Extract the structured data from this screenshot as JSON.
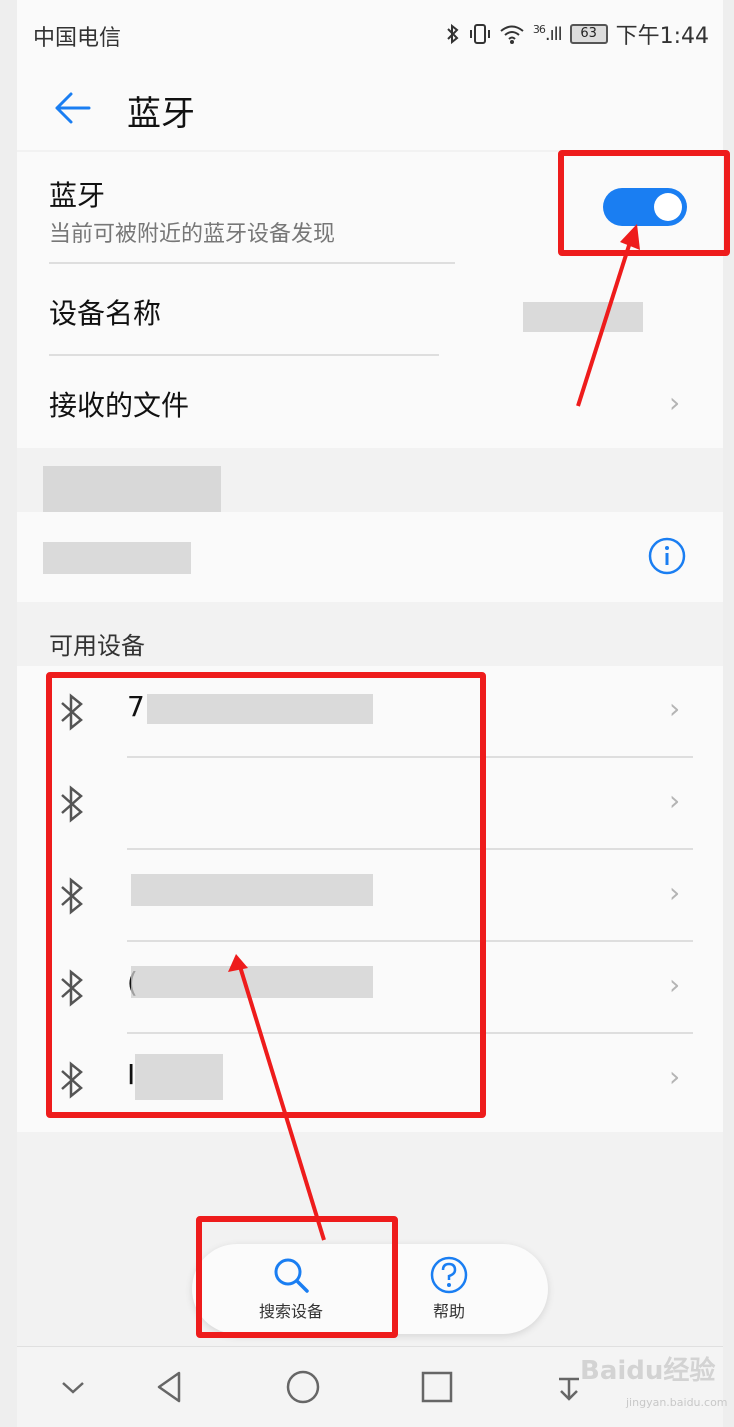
{
  "status_bar": {
    "carrier": "中国电信",
    "network": "36",
    "battery": "63",
    "time": "下午1:44"
  },
  "header": {
    "title": "蓝牙"
  },
  "bluetooth_toggle": {
    "label": "蓝牙",
    "subtitle": "当前可被附近的蓝牙设备发现",
    "enabled": true,
    "accent_color": "#1a7ef2"
  },
  "settings": {
    "device_name_label": "设备名称",
    "received_files_label": "接收的文件"
  },
  "available_section": {
    "label": "可用设备",
    "devices": [
      {
        "name_visible": "7"
      },
      {
        "name_visible": ""
      },
      {
        "name_visible": ""
      },
      {
        "name_visible": "("
      },
      {
        "name_visible": "I"
      }
    ]
  },
  "actions": {
    "search_label": "搜索设备",
    "help_label": "帮助"
  },
  "annotation_color": "#ee1c1c",
  "watermark": {
    "text": "Baidu经验",
    "sub": "jingyan.baidu.com"
  }
}
